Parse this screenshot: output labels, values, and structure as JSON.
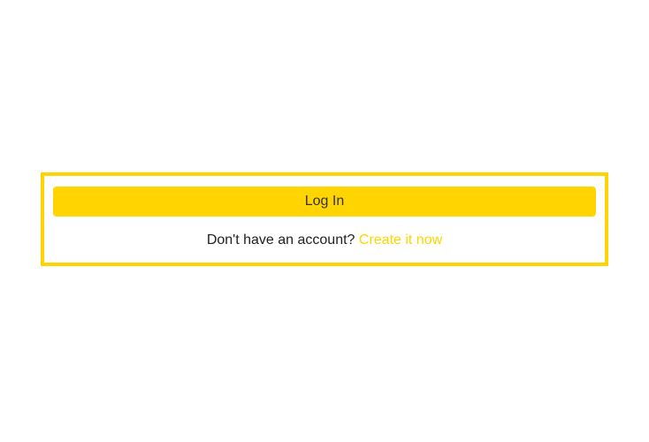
{
  "colors": {
    "accent": "#ffd400",
    "text": "#212121"
  },
  "login": {
    "button_label": "Log In",
    "prompt_text": "Don't have an account? ",
    "create_link_text": "Create it now"
  }
}
